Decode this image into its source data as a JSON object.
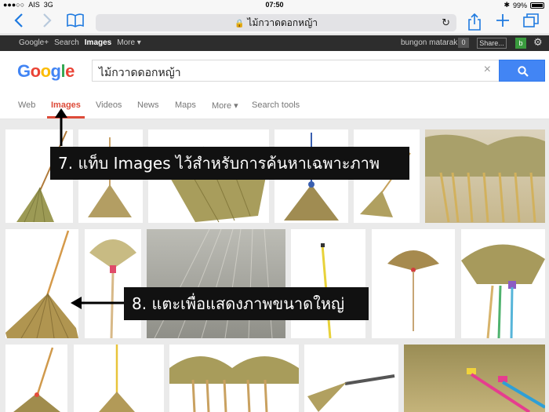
{
  "status": {
    "carrier": "AIS",
    "network": "3G",
    "time": "07:50",
    "battery": "99%"
  },
  "browser": {
    "url_text": "ไม้กวาดดอกหญ้า"
  },
  "gbar": {
    "links": [
      "Google+",
      "Search",
      "Images",
      "More ▾"
    ],
    "active_link": "Images",
    "user": "bungon matarak",
    "count": "0",
    "share": "Share...",
    "avatar": "b"
  },
  "search": {
    "logo": "Google",
    "query": "ไม้กวาดดอกหญ้า"
  },
  "tabs": [
    "Web",
    "Images",
    "Videos",
    "News",
    "Maps",
    "More ▾",
    "Search tools"
  ],
  "active_tab": "Images",
  "annotations": {
    "step7": "7. แท็บ Images ไว้สำหรับการค้นหาเฉพาะภาพ",
    "step8": "8. แตะเพื่อแสดงภาพขนาดใหญ่"
  },
  "colors": {
    "accent_blue": "#4285f4",
    "active_red": "#dd4b39",
    "safari_blue": "#1f7ae0"
  }
}
